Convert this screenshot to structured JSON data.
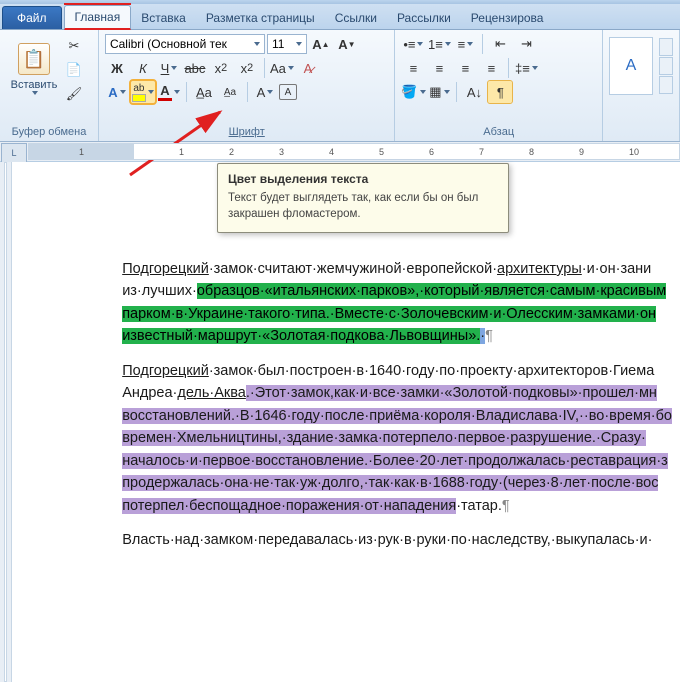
{
  "tabs": {
    "file": "Файл",
    "home": "Главная",
    "insert": "Вставка",
    "layout": "Разметка страницы",
    "refs": "Ссылки",
    "mail": "Рассылки",
    "review": "Рецензирова"
  },
  "clipboard": {
    "paste": "Вставить",
    "group": "Буфер обмена"
  },
  "font": {
    "name": "Calibri (Основной тек",
    "size": "11",
    "group": "Шрифт"
  },
  "para": {
    "group": "Абзац"
  },
  "tooltip": {
    "title": "Цвет выделения текста",
    "body": "Текст будет выглядеть так, как если бы он был закрашен фломастером."
  },
  "ruler_corner": "L",
  "doc": {
    "p1a": "Подгорецкий",
    "p1b": "·замок·считают·жемчужиной·европейской·",
    "p1c": "архитектуры",
    "p1d": "·и·он·зани",
    "p1e": "из·лучших·",
    "p1f": "образцов·«итальянских·парков»,·который·является·самым·красивым",
    "p1g": "парком·в·Украине·такого·типа.·Вместе·с·Золочевским·и·Олесским·замками·он",
    "p1h": "известный·маршрут·«Золотая·подкова·Львовщины».",
    "p2a": "Подгорецкий",
    "p2b": "·замок·был·построен·в·1640·году·по·проекту·архитекторов·Гиема",
    "p2c": "Андреа·",
    "p2d": "дель·Аква",
    "p2e": ".·Этот·замок,как·и·все·замки·«Золотой·подковы»·прошел·мн",
    "p2f": "восстановлений.·В·1646·году·после·приёма·короля·Владислава·IV,··во·время·бо",
    "p2g": "времен·Хмельництины,·здание·замка·потерпело·первое·разрушение.·Сразу·",
    "p2h": "началось·и·первое·восстановление.·Более·20·лет·продолжалась·реставрация·з",
    "p2i": "продержалась·она·не·так·уж·долго,·так·как·в·1688·году·(через·8·лет·после·вос",
    "p2j": "потерпел·беспощадное·поражения·от·нападения",
    "p2k": "·татар.",
    "p3": "Власть·над·замком·передавалась·из·рук·в·руки·по·наследству,·выкупалась·и·"
  }
}
